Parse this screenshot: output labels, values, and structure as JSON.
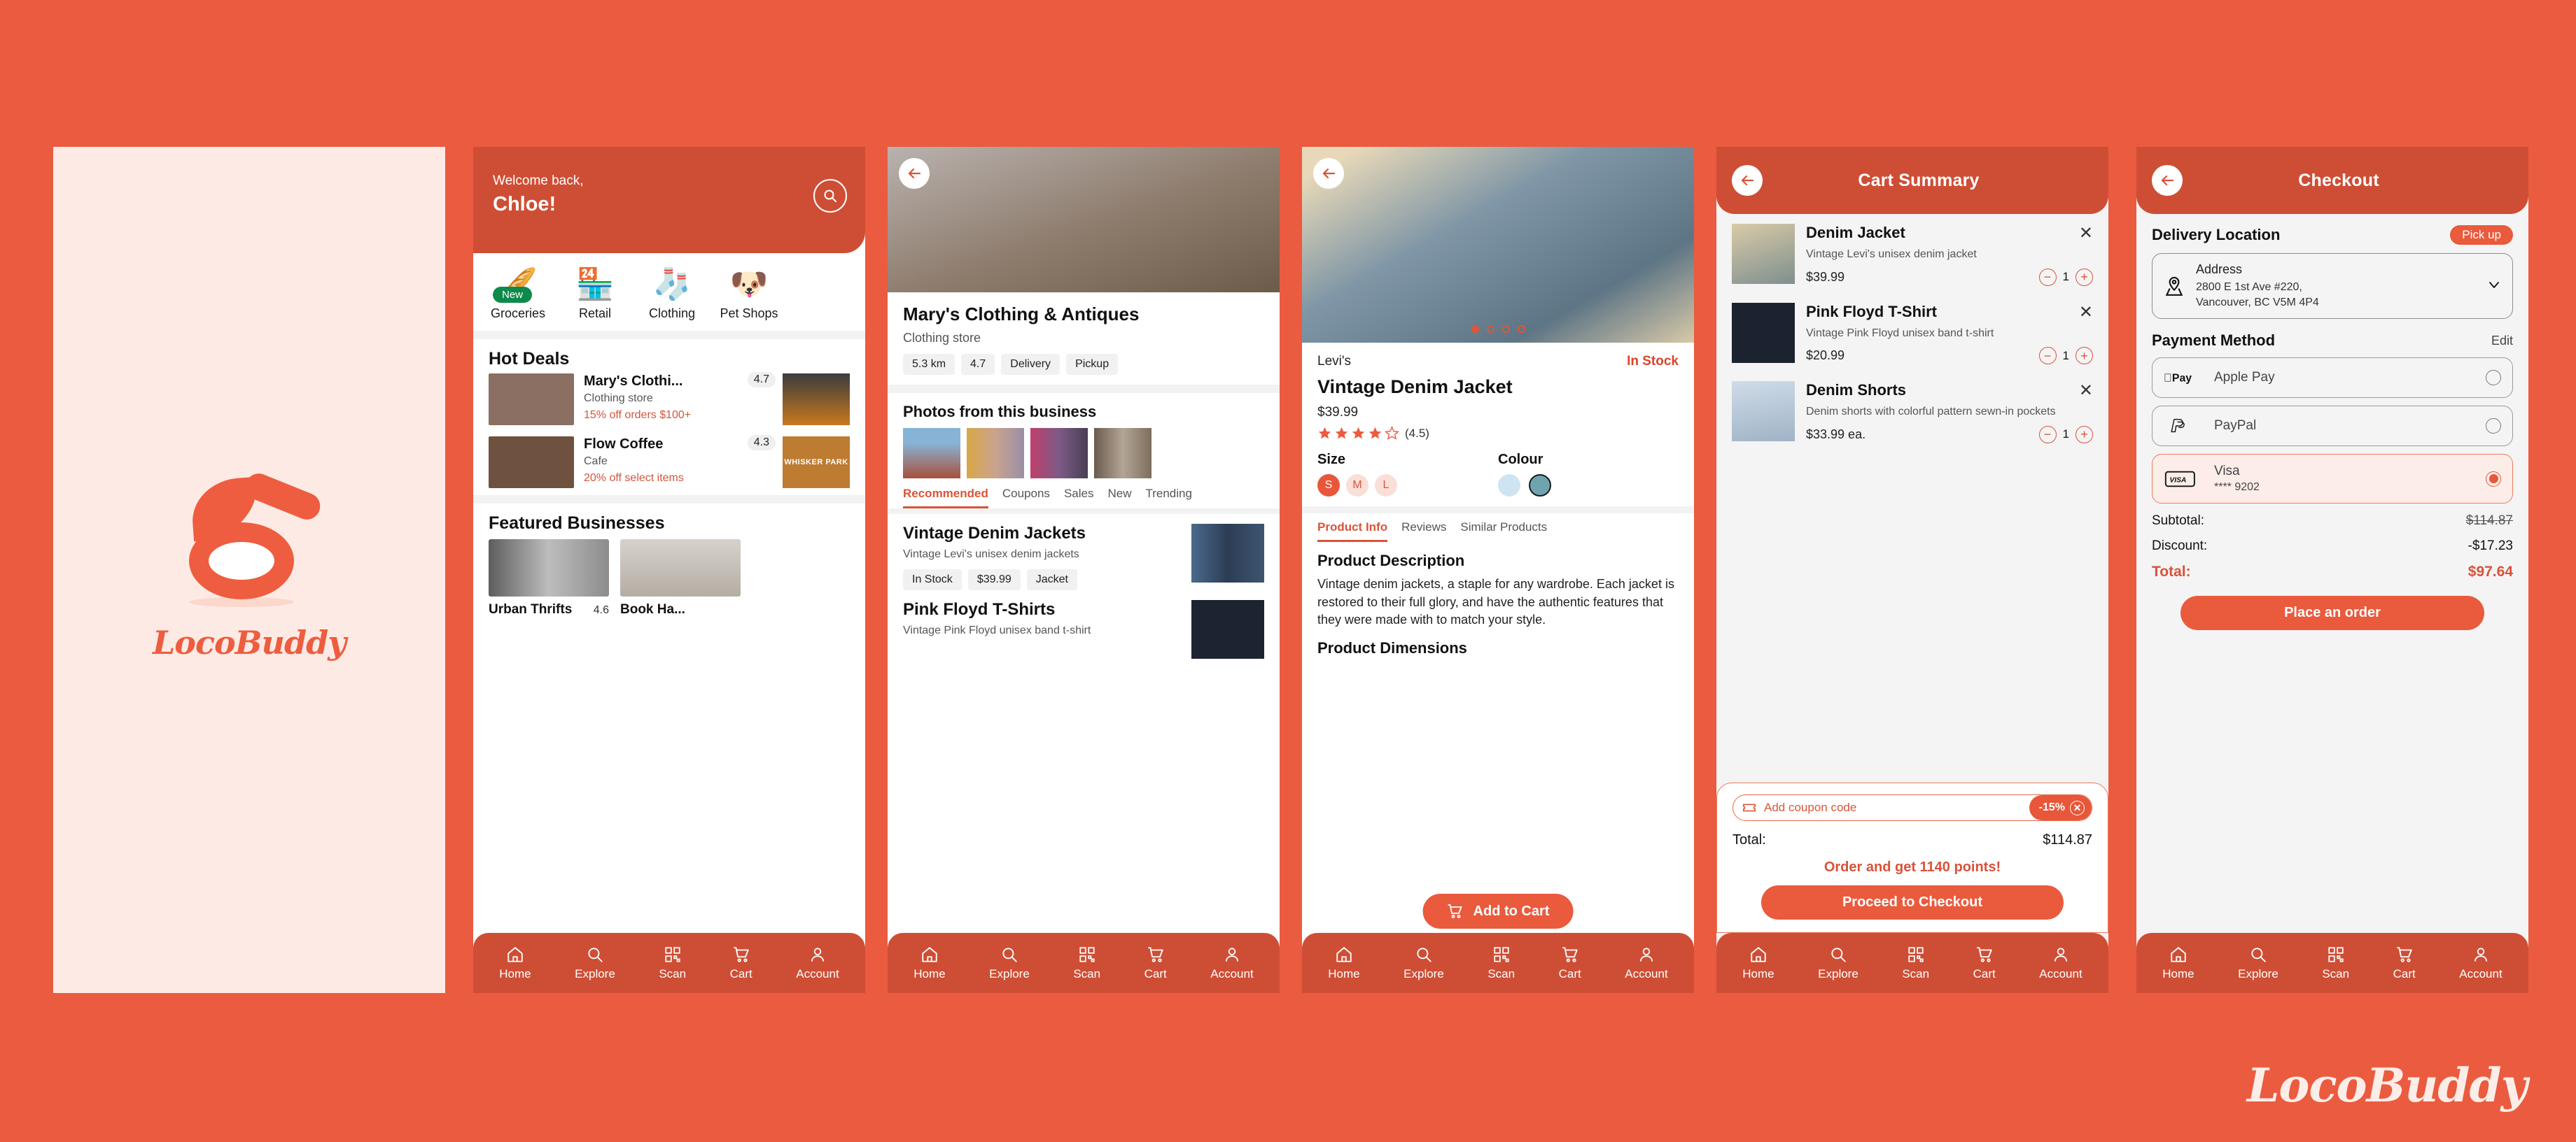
{
  "brand": {
    "name": "LocoBuddy",
    "accent": "#EE5D3F",
    "header_bg": "#CE4E35",
    "page_bg": "#EB5B3F",
    "splash_bg": "#FDEAE4",
    "wordmark_color": "#FDEDE8"
  },
  "bottom_nav": {
    "items": [
      {
        "label": "Home",
        "icon": "home-icon"
      },
      {
        "label": "Explore",
        "icon": "search-icon"
      },
      {
        "label": "Scan",
        "icon": "qr-scan-icon"
      },
      {
        "label": "Cart",
        "icon": "cart-icon"
      },
      {
        "label": "Account",
        "icon": "person-icon"
      }
    ]
  },
  "screen_splash": {
    "logo_name": "locobuddy-logo",
    "wordmark": "LocoBuddy"
  },
  "screen_home": {
    "welcome_line1": "Welcome back,",
    "welcome_line2": "Chloe!",
    "search_icon": "search-icon",
    "categories": [
      {
        "label": "Groceries",
        "emoji": "🥖",
        "badge": "New"
      },
      {
        "label": "Retail",
        "emoji": "🏪",
        "badge": ""
      },
      {
        "label": "Clothing",
        "emoji": "🧦",
        "badge": ""
      },
      {
        "label": "Pet Shops",
        "emoji": "🐶",
        "badge": ""
      }
    ],
    "hot_deals_title": "Hot Deals",
    "hot_deals": [
      {
        "name": "Mary's Clothi...",
        "category": "Clothing store",
        "offer": "15% off orders $100+",
        "rating": "4.7"
      },
      {
        "name": "Flow Coffee",
        "category": "Cafe",
        "offer": "20% off select items",
        "rating": "4.3"
      }
    ],
    "side_tiles": [
      {
        "name": "grocery-shelf-photo",
        "caption": ""
      },
      {
        "name": "whisker-park-banner",
        "caption": "WHISKER PARK"
      }
    ],
    "featured_title": "Featured Businesses",
    "featured": [
      {
        "name": "Urban Thrifts",
        "rating": "4.6"
      },
      {
        "name": "Book Ha...",
        "rating": ""
      }
    ]
  },
  "screen_business": {
    "back_icon": "back-arrow-icon",
    "name": "Mary's Clothing & Antiques",
    "category": "Clothing store",
    "chips": [
      "5.3 km",
      "4.7",
      "Delivery",
      "Pickup"
    ],
    "photos_title": "Photos from this business",
    "tabs": [
      {
        "label": "Recommended",
        "active": true
      },
      {
        "label": "Coupons",
        "active": false
      },
      {
        "label": "Sales",
        "active": false
      },
      {
        "label": "New",
        "active": false
      },
      {
        "label": "Trending",
        "active": false
      }
    ],
    "products": [
      {
        "title": "Vintage Denim Jackets",
        "subtitle": "Vintage Levi's unisex denim jackets",
        "chips": [
          "In Stock",
          "$39.99",
          "Jacket"
        ]
      },
      {
        "title": "Pink Floyd T-Shirts",
        "subtitle": "Vintage Pink Floyd unisex band t-shirt",
        "chips": []
      }
    ]
  },
  "screen_product": {
    "back_icon": "back-arrow-icon",
    "carousel_dots": 4,
    "carousel_active": 1,
    "brand": "Levi's",
    "stock": "In Stock",
    "title": "Vintage Denim Jacket",
    "price": "$39.99",
    "rating_value": "(4.5)",
    "rating_stars": 4.5,
    "size_label": "Size",
    "sizes": [
      {
        "label": "S",
        "selected": true
      },
      {
        "label": "M",
        "selected": false
      },
      {
        "label": "L",
        "selected": false
      }
    ],
    "colour_label": "Colour",
    "colours": [
      {
        "hex": "#CFE4F2",
        "selected": false
      },
      {
        "hex": "#6FA3B0",
        "selected": true
      }
    ],
    "tabs": [
      {
        "label": "Product Info",
        "active": true
      },
      {
        "label": "Reviews",
        "active": false
      },
      {
        "label": "Similar Products",
        "active": false
      }
    ],
    "description_title": "Product Description",
    "description": "Vintage denim jackets, a staple for any wardrobe. Each jacket is restored to their full glory, and have the authentic features that they were made with to match your style.",
    "dimensions_title": "Product Dimensions",
    "add_to_cart_label": "Add to Cart",
    "add_to_cart_icon": "cart-icon"
  },
  "screen_cart": {
    "back_icon": "back-arrow-icon",
    "title": "Cart Summary",
    "items": [
      {
        "name": "Denim Jacket",
        "desc": "Vintage Levi's unisex denim jacket",
        "price": "$39.99",
        "qty": "1",
        "remove_icon": "close-icon"
      },
      {
        "name": "Pink Floyd T-Shirt",
        "desc": "Vintage Pink Floyd unisex band t-shirt",
        "price": "$20.99",
        "qty": "1",
        "remove_icon": "close-icon"
      },
      {
        "name": "Denim Shorts",
        "desc": "Denim shorts with colorful pattern sewn-in pockets",
        "price": "$33.99 ea.",
        "qty": "1",
        "remove_icon": "close-icon"
      }
    ],
    "coupon_placeholder": "Add coupon code",
    "coupon_icon": "ticket-icon",
    "coupon_discount": "-15%",
    "coupon_clear_icon": "close-icon",
    "total_label": "Total:",
    "total_value": "$114.87",
    "points_text": "Order and get 1140 points!",
    "cta_label": "Proceed to Checkout"
  },
  "screen_checkout": {
    "back_icon": "back-arrow-icon",
    "title": "Checkout",
    "delivery_label": "Delivery Location",
    "pickup_label": "Pick up",
    "address_icon": "map-pin-icon",
    "address_label": "Address",
    "address_value": "2800 E 1st Ave #220,\nVancouver, BC V5M 4P4",
    "address_chevron": "chevron-down-icon",
    "payment_label": "Payment Method",
    "edit_label": "Edit",
    "payment_methods": [
      {
        "name": "Apple Pay",
        "sub": "",
        "logo": "apple-pay-logo",
        "selected": false
      },
      {
        "name": "PayPal",
        "sub": "",
        "logo": "paypal-logo",
        "selected": false
      },
      {
        "name": "Visa",
        "sub": "**** 9202",
        "logo": "visa-logo",
        "selected": true
      }
    ],
    "subtotal_label": "Subtotal:",
    "subtotal_value": "$114.87",
    "discount_label": "Discount:",
    "discount_value": "-$17.23",
    "total_label": "Total:",
    "total_value": "$97.64",
    "cta_label": "Place an order"
  }
}
